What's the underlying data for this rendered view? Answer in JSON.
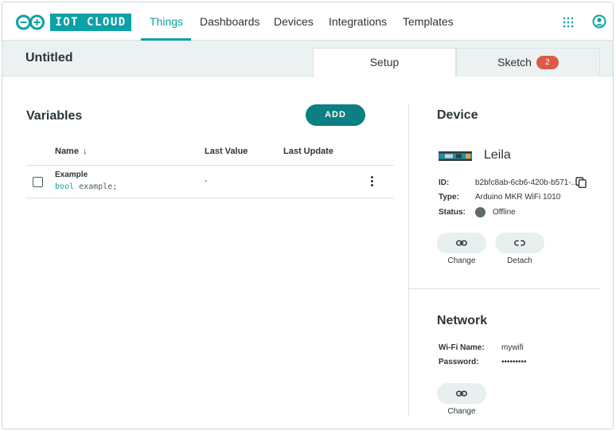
{
  "brand": {
    "logo_text": "IOT CLOUD",
    "accent": "#0ca1a6",
    "accent_dark": "#0b7f83",
    "badge_color": "#da5b4a"
  },
  "nav": {
    "items": [
      {
        "label": "Things",
        "active": true
      },
      {
        "label": "Dashboards"
      },
      {
        "label": "Devices"
      },
      {
        "label": "Integrations"
      },
      {
        "label": "Templates"
      }
    ],
    "icons": [
      "apps-grid-icon",
      "account-icon"
    ]
  },
  "thing": {
    "title": "Untitled"
  },
  "tabs": [
    {
      "label": "Setup",
      "active": true
    },
    {
      "label": "Sketch",
      "badge": "2"
    }
  ],
  "variables": {
    "title": "Variables",
    "add_label": "ADD",
    "columns": {
      "name": "Name",
      "sort_icon": "↓",
      "last_value": "Last Value",
      "last_update": "Last Update"
    },
    "rows": [
      {
        "name": "Example",
        "type": "bool",
        "declaration": "example;",
        "last_value": "-",
        "last_update": ""
      }
    ]
  },
  "device": {
    "title": "Device",
    "name": "Leila",
    "id_label": "ID:",
    "id_value": "b2bfc8ab-6cb6-420b-b571-...",
    "type_label": "Type:",
    "type_value": "Arduino MKR WiFi 1010",
    "status_label": "Status:",
    "status_value": "Offline",
    "change_label": "Change",
    "detach_label": "Detach"
  },
  "network": {
    "title": "Network",
    "wifi_label": "Wi-Fi Name:",
    "wifi_value": "mywifi",
    "password_label": "Password:",
    "password_value": "•••••••••",
    "change_label": "Change"
  }
}
